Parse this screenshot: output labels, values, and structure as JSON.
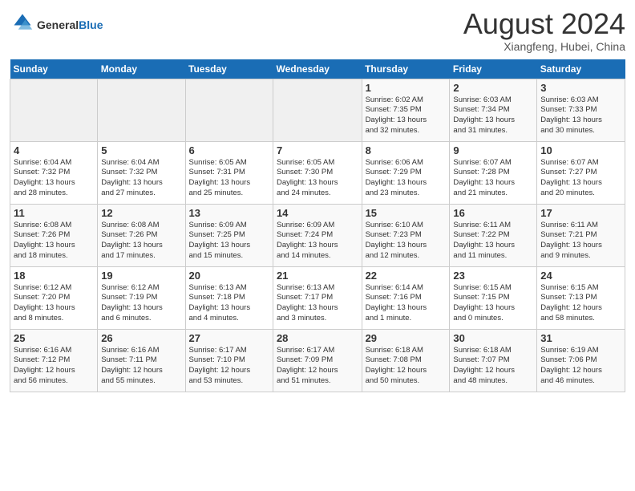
{
  "header": {
    "logo_general": "General",
    "logo_blue": "Blue",
    "month_year": "August 2024",
    "location": "Xiangfeng, Hubei, China"
  },
  "weekdays": [
    "Sunday",
    "Monday",
    "Tuesday",
    "Wednesday",
    "Thursday",
    "Friday",
    "Saturday"
  ],
  "weeks": [
    [
      {
        "day": "",
        "info": ""
      },
      {
        "day": "",
        "info": ""
      },
      {
        "day": "",
        "info": ""
      },
      {
        "day": "",
        "info": ""
      },
      {
        "day": "1",
        "info": "Sunrise: 6:02 AM\nSunset: 7:35 PM\nDaylight: 13 hours\nand 32 minutes."
      },
      {
        "day": "2",
        "info": "Sunrise: 6:03 AM\nSunset: 7:34 PM\nDaylight: 13 hours\nand 31 minutes."
      },
      {
        "day": "3",
        "info": "Sunrise: 6:03 AM\nSunset: 7:33 PM\nDaylight: 13 hours\nand 30 minutes."
      }
    ],
    [
      {
        "day": "4",
        "info": "Sunrise: 6:04 AM\nSunset: 7:32 PM\nDaylight: 13 hours\nand 28 minutes."
      },
      {
        "day": "5",
        "info": "Sunrise: 6:04 AM\nSunset: 7:32 PM\nDaylight: 13 hours\nand 27 minutes."
      },
      {
        "day": "6",
        "info": "Sunrise: 6:05 AM\nSunset: 7:31 PM\nDaylight: 13 hours\nand 25 minutes."
      },
      {
        "day": "7",
        "info": "Sunrise: 6:05 AM\nSunset: 7:30 PM\nDaylight: 13 hours\nand 24 minutes."
      },
      {
        "day": "8",
        "info": "Sunrise: 6:06 AM\nSunset: 7:29 PM\nDaylight: 13 hours\nand 23 minutes."
      },
      {
        "day": "9",
        "info": "Sunrise: 6:07 AM\nSunset: 7:28 PM\nDaylight: 13 hours\nand 21 minutes."
      },
      {
        "day": "10",
        "info": "Sunrise: 6:07 AM\nSunset: 7:27 PM\nDaylight: 13 hours\nand 20 minutes."
      }
    ],
    [
      {
        "day": "11",
        "info": "Sunrise: 6:08 AM\nSunset: 7:26 PM\nDaylight: 13 hours\nand 18 minutes."
      },
      {
        "day": "12",
        "info": "Sunrise: 6:08 AM\nSunset: 7:26 PM\nDaylight: 13 hours\nand 17 minutes."
      },
      {
        "day": "13",
        "info": "Sunrise: 6:09 AM\nSunset: 7:25 PM\nDaylight: 13 hours\nand 15 minutes."
      },
      {
        "day": "14",
        "info": "Sunrise: 6:09 AM\nSunset: 7:24 PM\nDaylight: 13 hours\nand 14 minutes."
      },
      {
        "day": "15",
        "info": "Sunrise: 6:10 AM\nSunset: 7:23 PM\nDaylight: 13 hours\nand 12 minutes."
      },
      {
        "day": "16",
        "info": "Sunrise: 6:11 AM\nSunset: 7:22 PM\nDaylight: 13 hours\nand 11 minutes."
      },
      {
        "day": "17",
        "info": "Sunrise: 6:11 AM\nSunset: 7:21 PM\nDaylight: 13 hours\nand 9 minutes."
      }
    ],
    [
      {
        "day": "18",
        "info": "Sunrise: 6:12 AM\nSunset: 7:20 PM\nDaylight: 13 hours\nand 8 minutes."
      },
      {
        "day": "19",
        "info": "Sunrise: 6:12 AM\nSunset: 7:19 PM\nDaylight: 13 hours\nand 6 minutes."
      },
      {
        "day": "20",
        "info": "Sunrise: 6:13 AM\nSunset: 7:18 PM\nDaylight: 13 hours\nand 4 minutes."
      },
      {
        "day": "21",
        "info": "Sunrise: 6:13 AM\nSunset: 7:17 PM\nDaylight: 13 hours\nand 3 minutes."
      },
      {
        "day": "22",
        "info": "Sunrise: 6:14 AM\nSunset: 7:16 PM\nDaylight: 13 hours\nand 1 minute."
      },
      {
        "day": "23",
        "info": "Sunrise: 6:15 AM\nSunset: 7:15 PM\nDaylight: 13 hours\nand 0 minutes."
      },
      {
        "day": "24",
        "info": "Sunrise: 6:15 AM\nSunset: 7:13 PM\nDaylight: 12 hours\nand 58 minutes."
      }
    ],
    [
      {
        "day": "25",
        "info": "Sunrise: 6:16 AM\nSunset: 7:12 PM\nDaylight: 12 hours\nand 56 minutes."
      },
      {
        "day": "26",
        "info": "Sunrise: 6:16 AM\nSunset: 7:11 PM\nDaylight: 12 hours\nand 55 minutes."
      },
      {
        "day": "27",
        "info": "Sunrise: 6:17 AM\nSunset: 7:10 PM\nDaylight: 12 hours\nand 53 minutes."
      },
      {
        "day": "28",
        "info": "Sunrise: 6:17 AM\nSunset: 7:09 PM\nDaylight: 12 hours\nand 51 minutes."
      },
      {
        "day": "29",
        "info": "Sunrise: 6:18 AM\nSunset: 7:08 PM\nDaylight: 12 hours\nand 50 minutes."
      },
      {
        "day": "30",
        "info": "Sunrise: 6:18 AM\nSunset: 7:07 PM\nDaylight: 12 hours\nand 48 minutes."
      },
      {
        "day": "31",
        "info": "Sunrise: 6:19 AM\nSunset: 7:06 PM\nDaylight: 12 hours\nand 46 minutes."
      }
    ]
  ]
}
